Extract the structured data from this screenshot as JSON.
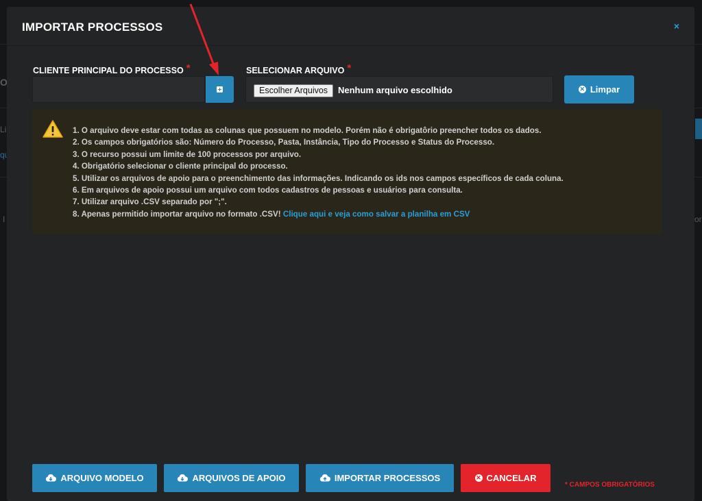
{
  "modal": {
    "title": "IMPORTAR PROCESSOS",
    "close_icon": "×"
  },
  "client_field": {
    "label": "CLIENTE PRINCIPAL DO PROCESSO",
    "required_mark": "*",
    "value": ""
  },
  "file_field": {
    "label": "SELECIONAR ARQUIVO",
    "required_mark": "*",
    "button_label": "Escolher Arquivos",
    "status": "Nenhum arquivo escolhido"
  },
  "clear_button": {
    "label": "Limpar",
    "icon": "circle-x-icon"
  },
  "notice": {
    "icon": "warning-icon",
    "items": [
      "1. O arquivo deve estar com todas as colunas que possuem no modelo. Porém não é obrigatôrio preencher todos os dados.",
      "2. Os campos obrigatórios são: Número do Processo, Pasta, Instância, Tipo do Processo e Status do Processo.",
      "3. O recurso possui um limite de 100 processos por arquivo.",
      "4. Obrigatório selecionar o cliente principal do processo.",
      "5. Utilizar os arquivos de apoio para o preenchimento das informações. Indicando os ids nos campos específicos de cada coluna.",
      "6. Em arquivos de apoio possui um arquivo com todos cadastros de pessoas e usuários para consulta.",
      "7. Utilizar arquivo .CSV separado por \";\"."
    ],
    "last_item_text": "8. Apenas permitido importar arquivo no formato .CSV!",
    "last_item_link": "Clique aqui e veja como salvar a planilha em CSV"
  },
  "footer": {
    "buttons": [
      {
        "label": "ARQUIVO MODELO",
        "icon": "cloud-download-icon"
      },
      {
        "label": "ARQUIVOS DE APOIO",
        "icon": "cloud-download-icon"
      },
      {
        "label": "IMPORTAR PROCESSOS",
        "icon": "cloud-upload-icon"
      },
      {
        "label": "CANCELAR",
        "icon": "circle-x-icon"
      }
    ],
    "required_note": "* CAMPOS OBRIGATÓRIOS"
  },
  "background": {
    "fragments": [
      "OC",
      "Lin",
      "qu",
      "I",
      "orr"
    ]
  },
  "colors": {
    "accent": "#2785b8",
    "danger": "#e3242b",
    "link": "#2a9fd6",
    "warning_bg": "#2a261a",
    "annotation_arrow": "#e3242b"
  }
}
